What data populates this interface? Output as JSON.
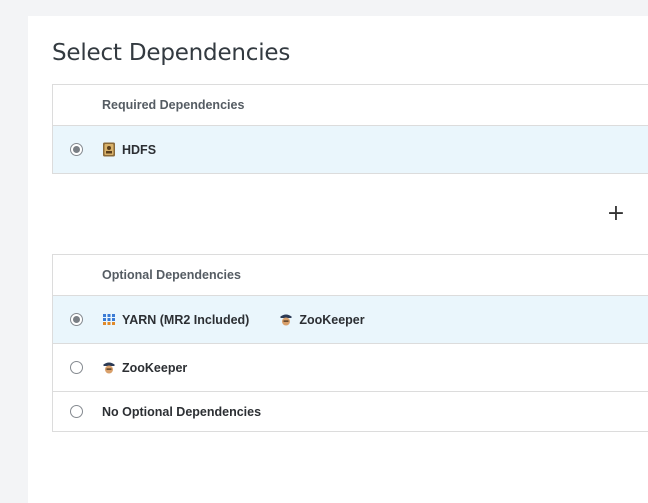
{
  "page": {
    "title": "Select Dependencies"
  },
  "required": {
    "header": "Required Dependencies",
    "rows": [
      {
        "selected": true,
        "services": [
          {
            "name": "HDFS",
            "icon": "hdfs-icon"
          }
        ]
      }
    ]
  },
  "add_button": {
    "label": "+"
  },
  "optional": {
    "header": "Optional Dependencies",
    "rows": [
      {
        "selected": true,
        "services": [
          {
            "name": "YARN (MR2 Included)",
            "icon": "yarn-icon"
          },
          {
            "name": "ZooKeeper",
            "icon": "zookeeper-icon"
          }
        ]
      },
      {
        "selected": false,
        "services": [
          {
            "name": "ZooKeeper",
            "icon": "zookeeper-icon"
          }
        ]
      },
      {
        "selected": false,
        "services": [
          {
            "name": "No Optional Dependencies",
            "icon": ""
          }
        ]
      }
    ]
  },
  "colors": {
    "selected_row": "#eaf6fc",
    "border": "#dcdcdc",
    "radio_dot": "#7a7f85"
  }
}
